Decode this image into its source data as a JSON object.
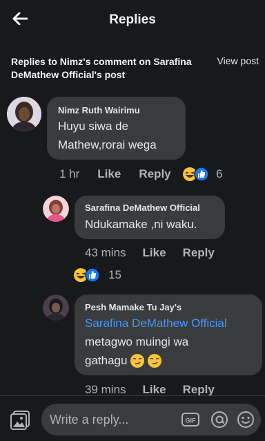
{
  "header": {
    "title": "Replies"
  },
  "context": {
    "text": "Replies to Nimz's comment on Sarafina DeMathew Official's post",
    "view_post": "View post"
  },
  "comments": [
    {
      "author": "Nimz Ruth Wairimu",
      "line1": "Huyu siwa de",
      "line2": "Mathew,rorai wega",
      "time": "1 hr",
      "like": "Like",
      "reply": "Reply",
      "reaction_count": "6"
    },
    {
      "author": "Sarafina DeMathew Official",
      "line1": "Ndukamake ,ni waku.",
      "time": "43 mins",
      "like": "Like",
      "reply": "Reply",
      "reaction_count": "15"
    },
    {
      "author": "Pesh Mamake Tu Jay's",
      "mention": "Sarafina DeMathew Official",
      "line1": "metagwo muingi wa",
      "line2": "gathagu",
      "time": "39 mins",
      "like": "Like",
      "reply": "Reply"
    }
  ],
  "composer": {
    "placeholder": "Write a reply..."
  },
  "colors": {
    "background": "#18191a",
    "bubble": "#3a3b3c",
    "mention": "#4599ff",
    "like_blue": "#1877f2",
    "haha_yellow": "#f7c43b"
  },
  "icons": [
    "back-arrow-icon",
    "photo-icon",
    "gif-icon",
    "at-mention-icon",
    "emoji-icon",
    "haha-reaction-icon",
    "like-reaction-icon",
    "smirk-emoji-icon"
  ]
}
